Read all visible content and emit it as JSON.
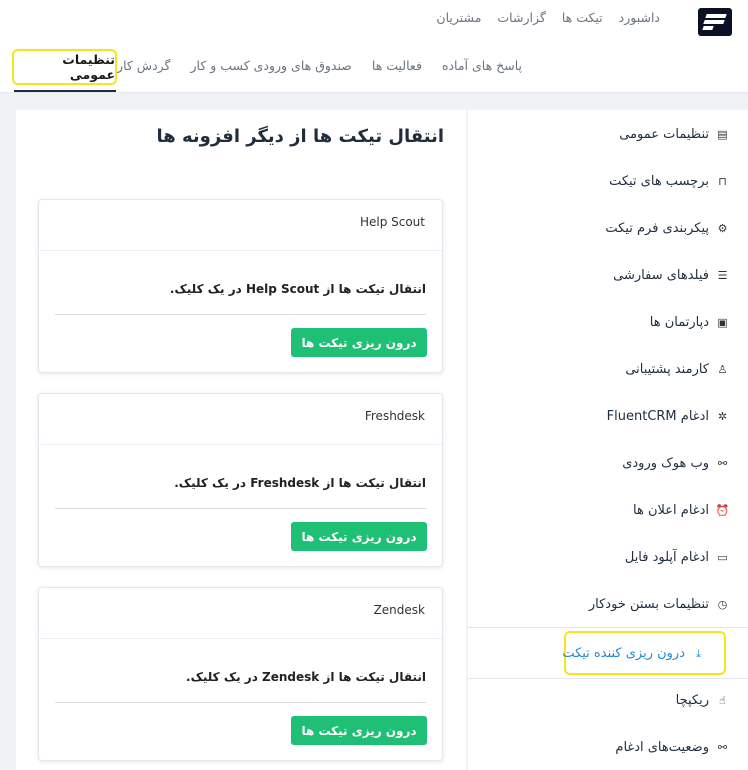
{
  "topnav": {
    "items": [
      "داشبورد",
      "تیکت ها",
      "گزارشات",
      "مشتریان"
    ]
  },
  "subnav": {
    "items": [
      "پاسخ های آماده",
      "فعالیت ها",
      "صندوق های ورودی کسب و کار",
      "گردش کارها"
    ],
    "active": "تنظیمات عمومی"
  },
  "main": {
    "title": "انتقال تیکت ها از دیگر افزونه ها",
    "cards": [
      {
        "name": "Help Scout",
        "desc": "انتقال تیکت ها از Help Scout در یک کلیک.",
        "button": "درون ریزی تیکت ها"
      },
      {
        "name": "Freshdesk",
        "desc": "انتقال تیکت ها از Freshdesk در یک کلیک.",
        "button": "درون ریزی تیکت ها"
      },
      {
        "name": "Zendesk",
        "desc": "انتقال تیکت ها از Zendesk در یک کلیک.",
        "button": "درون ریزی تیکت ها"
      }
    ]
  },
  "sidebar": {
    "items": [
      {
        "label": "تنظیمات عمومی",
        "icon": "document-icon"
      },
      {
        "label": "برچسب های تیکت",
        "icon": "bookmark-icon"
      },
      {
        "label": "پیکربندی فرم تیکت",
        "icon": "gear-icon"
      },
      {
        "label": "فیلدهای سفارشی",
        "icon": "list-icon"
      },
      {
        "label": "دپارتمان ها",
        "icon": "briefcase-icon"
      },
      {
        "label": "کارمند پشتیبانی",
        "icon": "user-icon"
      },
      {
        "label": "ادغام FluentCRM",
        "icon": "puzzle-icon"
      },
      {
        "label": "وب هوک ورودی",
        "icon": "webhook-icon"
      },
      {
        "label": "ادغام اعلان ها",
        "icon": "alarm-icon"
      },
      {
        "label": "ادغام آپلود فایل",
        "icon": "folder-icon"
      },
      {
        "label": "تنظیمات بستن خودکار",
        "icon": "timer-icon"
      },
      {
        "label": "درون ریزی کننده تیکت",
        "icon": "download-icon",
        "active": true
      },
      {
        "label": "ریکپچا",
        "icon": "hand-icon"
      },
      {
        "label": "وضعیت‌های ادغام",
        "icon": "integration-icon"
      }
    ]
  },
  "colors": {
    "accent_green": "#1fbf75",
    "active_blue": "#1f8ad2",
    "highlight_yellow": "#f4e61a"
  }
}
